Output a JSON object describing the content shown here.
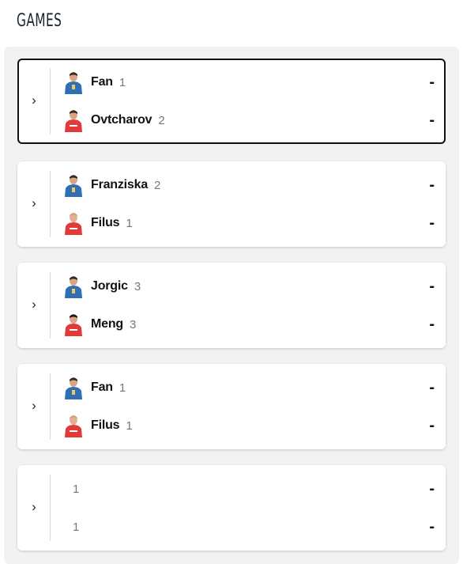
{
  "section_title": "GAMES",
  "colors": {
    "home_team": "#2f6fb5",
    "away_team": "#e23a3a",
    "panel_bg": "#f2f2f2"
  },
  "games": [
    {
      "home": {
        "name": "Fan",
        "sets": "1",
        "score": "-"
      },
      "away": {
        "name": "Ovtcharov",
        "sets": "2",
        "score": "-"
      },
      "active": true
    },
    {
      "home": {
        "name": "Franziska",
        "sets": "2",
        "score": "-"
      },
      "away": {
        "name": "Filus",
        "sets": "1",
        "score": "-"
      }
    },
    {
      "home": {
        "name": "Jorgic",
        "sets": "3",
        "score": "-"
      },
      "away": {
        "name": "Meng",
        "sets": "3",
        "score": "-"
      }
    },
    {
      "home": {
        "name": "Fan",
        "sets": "1",
        "score": "-"
      },
      "away": {
        "name": "Filus",
        "sets": "1",
        "score": "-"
      }
    },
    {
      "home": {
        "name": "",
        "sets": "1",
        "score": "-"
      },
      "away": {
        "name": "",
        "sets": "1",
        "score": "-"
      }
    }
  ],
  "icons": {
    "expand": "chevron-right-icon",
    "home_avatar": "blue-jersey-player-icon",
    "away_avatar": "red-jersey-player-icon"
  }
}
